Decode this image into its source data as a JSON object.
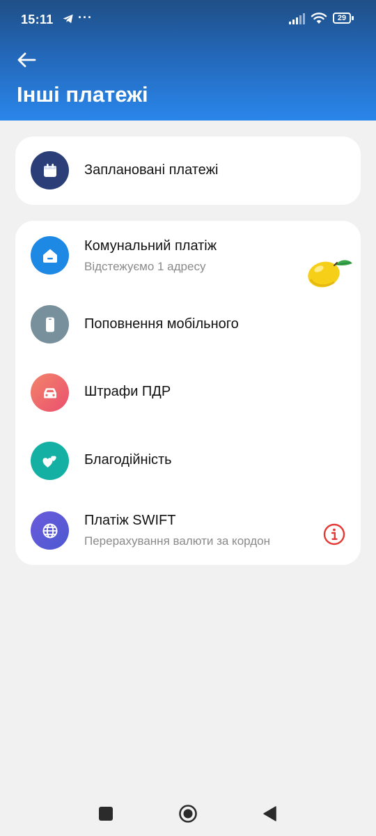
{
  "status_bar": {
    "time": "15:11",
    "more": "···",
    "battery": "29"
  },
  "header": {
    "title": "Інші платежі"
  },
  "scheduled": {
    "title": "Заплановані платежі",
    "icon": "calendar-icon",
    "color": "#2c3e78"
  },
  "items": [
    {
      "title": "Комунальний платіж",
      "subtitle": "Відстежуємо 1 адресу",
      "icon": "home-icon",
      "color": "#1e88e5"
    },
    {
      "title": "Поповнення мобільного",
      "subtitle": "",
      "icon": "phone-icon",
      "color": "#78909c"
    },
    {
      "title": "Штрафи ПДР",
      "subtitle": "",
      "icon": "car-icon",
      "color": "#ef5f63"
    },
    {
      "title": "Благодійність",
      "subtitle": "",
      "icon": "hearts-icon",
      "color": "#14b0a4"
    },
    {
      "title": "Платіж SWIFT",
      "subtitle": "Перерахування валюти за кордон",
      "icon": "globe-icon",
      "color": "#5b5bd6"
    }
  ],
  "info_icon": "info-icon",
  "colors": {
    "header_top": "#1f4f86",
    "header_bottom": "#2a86ea",
    "background": "#f1f1f1",
    "info": "#e53935"
  }
}
